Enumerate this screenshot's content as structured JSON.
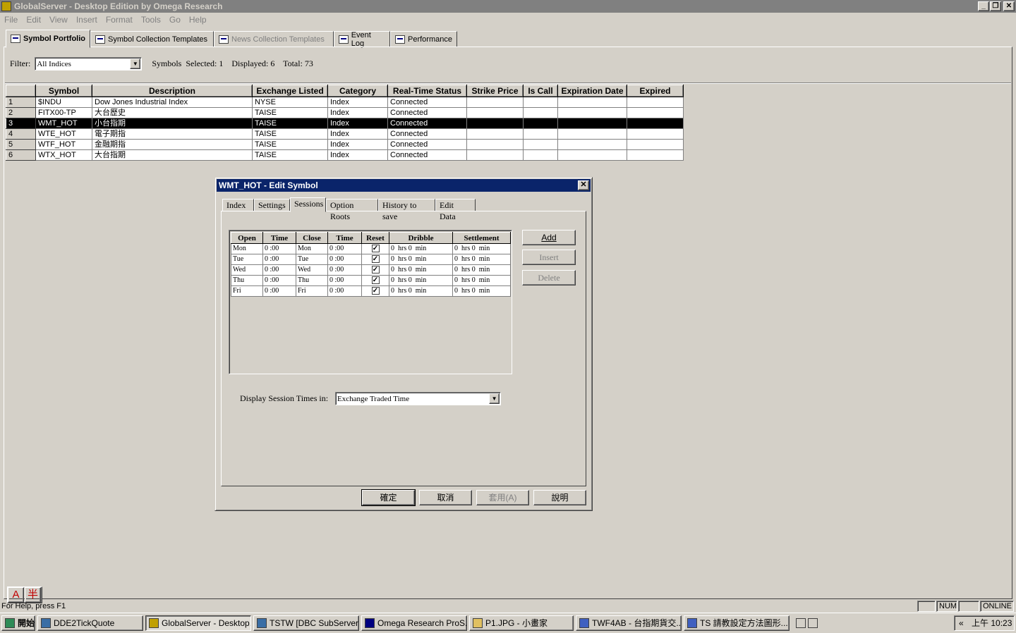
{
  "window": {
    "title": "GlobalServer - Desktop Edition by Omega Research",
    "controls": [
      "_",
      "❐",
      "✕"
    ]
  },
  "menu": [
    "File",
    "Edit",
    "View",
    "Insert",
    "Format",
    "Tools",
    "Go",
    "Help"
  ],
  "main_tabs": [
    {
      "label": "Symbol Portfolio",
      "state": "active"
    },
    {
      "label": "Symbol Collection Templates",
      "state": "normal"
    },
    {
      "label": "News Collection Templates",
      "state": "disabled"
    },
    {
      "label": "Event Log",
      "state": "normal"
    },
    {
      "label": "Performance",
      "state": "normal"
    }
  ],
  "filter": {
    "label": "Filter:",
    "value": "All Indices",
    "summary": "Symbols  Selected: 1    Displayed: 6    Total: 73"
  },
  "symbols_table": {
    "columns": [
      "",
      "Symbol",
      "Description",
      "Exchange Listed",
      "Category",
      "Real-Time Status",
      "Strike Price",
      "Is Call",
      "Expiration Date",
      "Expired"
    ],
    "rows": [
      [
        "1",
        "$INDU",
        "Dow Jones Industrial Index",
        "NYSE",
        "Index",
        "Connected",
        "",
        "",
        "",
        ""
      ],
      [
        "2",
        "FITX00-TP",
        "大台歷史",
        "TAISE",
        "Index",
        "Connected",
        "",
        "",
        "",
        ""
      ],
      [
        "3",
        "WMT_HOT",
        "小台指期",
        "TAISE",
        "Index",
        "Connected",
        "",
        "",
        "",
        ""
      ],
      [
        "4",
        "WTE_HOT",
        "電子期指",
        "TAISE",
        "Index",
        "Connected",
        "",
        "",
        "",
        ""
      ],
      [
        "5",
        "WTF_HOT",
        "金融期指",
        "TAISE",
        "Index",
        "Connected",
        "",
        "",
        "",
        ""
      ],
      [
        "6",
        "WTX_HOT",
        "大台指期",
        "TAISE",
        "Index",
        "Connected",
        "",
        "",
        "",
        ""
      ]
    ],
    "selected_row": 3
  },
  "dialog": {
    "title": "WMT_HOT - Edit Symbol",
    "close": "✕",
    "tabs": [
      "Index",
      "Settings",
      "Sessions",
      "Option Roots",
      "History to save",
      "Edit Data"
    ],
    "active_tab": "Sessions",
    "sessions": {
      "columns": [
        "Open",
        "Time",
        "Close",
        "Time",
        "Reset",
        "Dribble",
        "Settlement"
      ],
      "rows": [
        {
          "open": "Mon",
          "open_time": "0 :00",
          "close": "Mon",
          "close_time": "0 :00",
          "reset": "✓",
          "dribble": "0  hrs 0  min",
          "settlement": "0  hrs 0  min"
        },
        {
          "open": "Tue",
          "open_time": "0 :00",
          "close": "Tue",
          "close_time": "0 :00",
          "reset": "✓",
          "dribble": "0  hrs 0  min",
          "settlement": "0  hrs 0  min"
        },
        {
          "open": "Wed",
          "open_time": "0 :00",
          "close": "Wed",
          "close_time": "0 :00",
          "reset": "✓",
          "dribble": "0  hrs 0  min",
          "settlement": "0  hrs 0  min"
        },
        {
          "open": "Thu",
          "open_time": "0 :00",
          "close": "Thu",
          "close_time": "0 :00",
          "reset": "✓",
          "dribble": "0  hrs 0  min",
          "settlement": "0  hrs 0  min"
        },
        {
          "open": "Fri",
          "open_time": "0 :00",
          "close": "Fri",
          "close_time": "0 :00",
          "reset": "✓",
          "dribble": "0  hrs 0  min",
          "settlement": "0  hrs 0  min"
        }
      ],
      "add_label": "Add",
      "insert_label": "Insert",
      "delete_label": "Delete",
      "display_label": "Display Session Times in:",
      "display_value": "Exchange Traded Time"
    },
    "buttons": {
      "ok": "確定",
      "cancel": "取消",
      "apply": "套用(A)",
      "help": "說明"
    }
  },
  "statusbar": {
    "help_text": "For Help, press F1",
    "num": "NUM",
    "online": "ONLINE",
    "ime": [
      "A",
      "半"
    ]
  },
  "taskbar": {
    "start": "開始",
    "tasks": [
      {
        "label": "DDE2TickQuote",
        "active": false
      },
      {
        "label": "GlobalServer - Desktop...",
        "active": true
      },
      {
        "label": "TSTW [DBC SubServer]",
        "active": false
      },
      {
        "label": "Omega Research ProS...",
        "active": false
      },
      {
        "label": "P1.JPG - 小畫家",
        "active": false
      },
      {
        "label": "TWF4AB - 台指期貨交...",
        "active": false
      },
      {
        "label": "TS 請教設定方法圖形...",
        "active": false
      }
    ],
    "clock": "上午 10:23",
    "tray_arrow": "«"
  }
}
